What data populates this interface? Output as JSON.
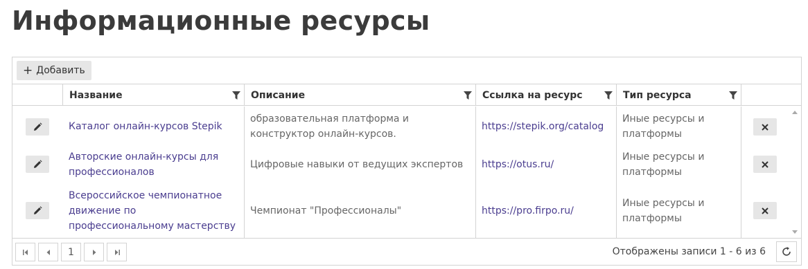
{
  "page": {
    "title": "Информационные ресурсы"
  },
  "toolbar": {
    "add_label": "Добавить",
    "add_icon": "plus-icon"
  },
  "columns": [
    {
      "label": "Название",
      "filter_icon": "filter-icon"
    },
    {
      "label": "Описание",
      "filter_icon": "filter-icon"
    },
    {
      "label": "Ссылка на ресурс",
      "filter_icon": "filter-icon"
    },
    {
      "label": "Тип ресурса",
      "filter_icon": "filter-icon"
    }
  ],
  "rows": [
    {
      "name": "Каталог онлайн-курсов Stepik",
      "description": "образовательная платформа и конструктор онлайн-курсов.",
      "link": "https://stepik.org/catalog",
      "type": "Иные ресурсы и платформы"
    },
    {
      "name": "Авторские онлайн-курсы для профессионалов",
      "description": "Цифровые навыки от ведущих экспертов",
      "link": "https://otus.ru/",
      "type": "Иные ресурсы и платформы"
    },
    {
      "name": "Всероссийское чемпионатное движение по профессиональному мастерству",
      "description": "Чемпионат \"Профессионалы\"",
      "link": "https://pro.firpo.ru/",
      "type": "Иные ресурсы и платформы"
    }
  ],
  "pager": {
    "current_page": "1",
    "info": "Отображены записи 1 - 6 из 6"
  },
  "colors": {
    "link": "#4a3d8f",
    "border": "#d3d3d3",
    "button_bg": "#e6e6e6",
    "title": "#3b3b3b"
  }
}
